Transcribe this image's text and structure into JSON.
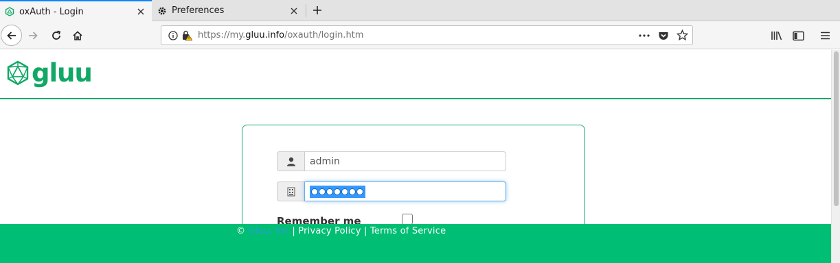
{
  "browser": {
    "tabs": [
      {
        "title": "oxAuth - Login",
        "active": true
      },
      {
        "title": "Preferences",
        "active": false
      }
    ],
    "url": {
      "prefix": "https://my.",
      "domain": "gluu.info",
      "path": "/oxauth/login.htm"
    }
  },
  "site": {
    "logo_text": "gluu",
    "brand_color": "#11a866"
  },
  "login": {
    "username_value": "admin",
    "password_length": 7,
    "remember_label": "Remember me",
    "remember_checked": false
  },
  "footer": {
    "copyright": "©",
    "company": "Gluu, Inc",
    "separator1": "|",
    "privacy": "Privacy Policy",
    "separator2": "|",
    "terms": "Terms of Service",
    "background": "#00be73"
  }
}
